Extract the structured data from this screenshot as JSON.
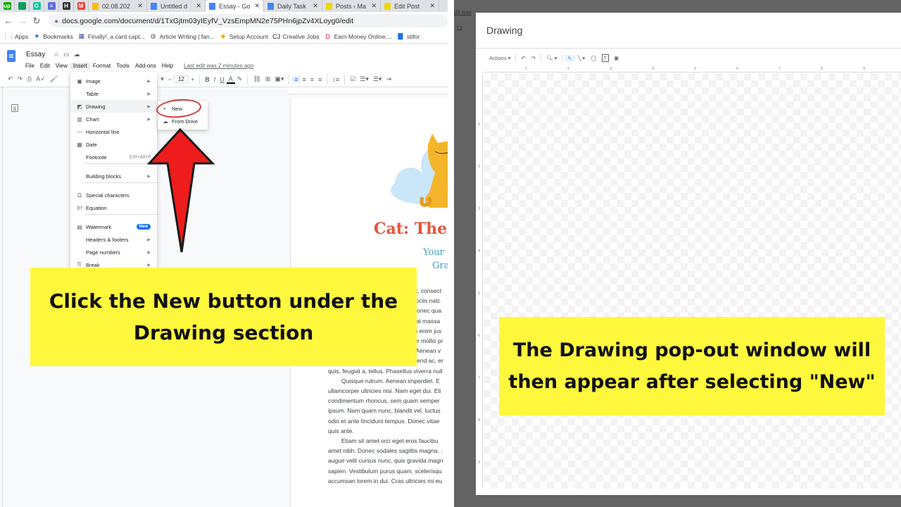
{
  "browser": {
    "pinned_tabs": [
      {
        "icon": "upwork-icon",
        "glyph": "up",
        "color": "#14a800"
      },
      {
        "icon": "sheets-icon",
        "glyph": "",
        "color": "#0f9d58"
      },
      {
        "icon": "grammarly-icon",
        "glyph": "G",
        "color": "#15c39a"
      },
      {
        "icon": "tool-icon",
        "glyph": "≡",
        "color": "#5b6ee1"
      },
      {
        "icon": "h-icon",
        "glyph": "H",
        "color": "#333333"
      },
      {
        "icon": "gmail-icon",
        "glyph": "M",
        "color": "#ea4335"
      }
    ],
    "tabs": [
      {
        "title": "02.08.202",
        "icon_color": "#fbbc04",
        "active": false
      },
      {
        "title": "Untitled d",
        "icon_color": "#4285f4",
        "active": false
      },
      {
        "title": "Essay - Go",
        "icon_color": "#4285f4",
        "active": true
      },
      {
        "title": "Daily Task",
        "icon_color": "#4285f4",
        "active": false
      },
      {
        "title": "Posts ‹ Ma",
        "icon_color": "#f2d600",
        "active": false
      },
      {
        "title": "Edit Post",
        "icon_color": "#f2d600",
        "active": false
      }
    ],
    "url": "docs.google.com/document/d/1TxGjtm03yIEyfV_VzsEmpMN2e75PHn6jpZv4XLoyg0/edit",
    "bookmarks": [
      "Apps",
      "Bookmarks",
      "Finally!, a card capt...",
      "Article Writing | fan...",
      "Setup Account",
      "Creative Jobs",
      "Earn Money Online:...",
      "stifor"
    ]
  },
  "docs": {
    "title": "Essay",
    "menu": [
      "File",
      "Edit",
      "View",
      "Insert",
      "Format",
      "Tools",
      "Add-ons",
      "Help"
    ],
    "last_edit": "Last edit was 2 minutes ago",
    "font_size": "12",
    "insert_menu": [
      {
        "label": "Image",
        "icon": "▣",
        "submenu": true
      },
      {
        "label": "Table",
        "icon": "",
        "submenu": true
      },
      {
        "label": "Drawing",
        "icon": "◩",
        "submenu": true
      },
      {
        "label": "Chart",
        "icon": "▥",
        "submenu": true
      },
      {
        "label": "Horizontal line",
        "icon": "—",
        "submenu": false
      },
      {
        "label": "Date",
        "icon": "▦",
        "submenu": false
      },
      {
        "label": "Footnote",
        "icon": "",
        "shortcut": "Ctrl+Alt+F"
      },
      {
        "label": "Building blocks",
        "icon": "",
        "submenu": true
      },
      {
        "label": "Special characters",
        "icon": "Ω"
      },
      {
        "label": "Equation",
        "icon": "π²"
      },
      {
        "label": "Watermark",
        "icon": "▤",
        "badge": "New"
      },
      {
        "label": "Headers & footers",
        "icon": "",
        "submenu": true
      },
      {
        "label": "Page numbers",
        "icon": "",
        "submenu": true
      },
      {
        "label": "Break",
        "icon": "⎘",
        "submenu": true
      }
    ],
    "drawing_submenu": [
      {
        "label": "New",
        "icon": "+"
      },
      {
        "label": "From Drive",
        "icon": "☁"
      }
    ],
    "page": {
      "heading": "Cat: The",
      "subtitle_1": "Your",
      "subtitle_2": "Gra",
      "body_lines": [
        "et, consect",
        "sociis natc",
        "Donec qua",
        "uat massa",
        "In enim jus",
        "de mollis pr",
        ". Aenean v",
        "lifend ac, er",
        "quis, feugiat a, tellus. Phasellus viverra null",
        "        Quisque rutrum. Aenean imperdiet. E",
        "ullamcorper ultricies nisi. Nam eget dui. Eti",
        "condimentum rhoncus, sem quam semper",
        "ipsum. Nam quam nunc, blandit vel, luctus",
        "odio et ante tincidunt tempus. Donec vitae",
        "quis ante.",
        "        Etiam sit amet orci eget eros faucibu",
        "amet nibh. Donec sodales sagittis magna. :",
        "augue velit cursus nunc, quis gravida magn",
        "sapien. Vestibulum purus quam, scelerisqu",
        "accumsan lorem in dui. Cras ultricies mi eu"
      ]
    },
    "callout": "Click the New button under the Drawing section"
  },
  "drawing": {
    "behind_text": "dit was",
    "behind_font_size": "12",
    "title": "Drawing",
    "toolbar": {
      "actions": "Actions ▾",
      "undo": "↶",
      "redo": "↷",
      "zoom": "🔍︎ ▾",
      "select": "↖",
      "line": "╲ ▾",
      "shape": "◯",
      "textbox": "T",
      "image": "▣"
    },
    "ruler_labels": [
      "1",
      "2",
      "3",
      "4",
      "5",
      "6",
      "7",
      "8",
      "9"
    ],
    "vertical_ruler_labels": [
      "1",
      "2",
      "3",
      "4",
      "5",
      "6",
      "7",
      "8",
      "9"
    ],
    "callout": "The Drawing pop-out window will then appear after selecting \"New\""
  }
}
